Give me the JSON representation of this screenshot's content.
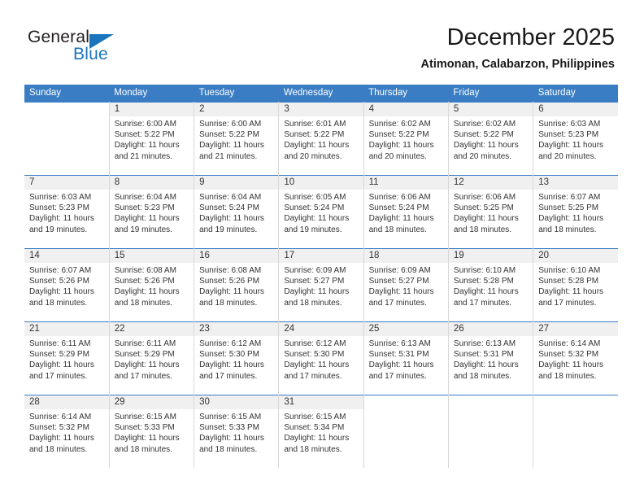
{
  "logo": {
    "word_top": "General",
    "word_bottom": "Blue",
    "triangle_color": "#1b75bc"
  },
  "header": {
    "title": "December 2025",
    "subtitle": "Atimonan, Calabarzon, Philippines"
  },
  "theme": {
    "header_blue": "#3b7dc4",
    "daynum_band": "#f0f0f0",
    "text": "#333333"
  },
  "weekday_headers": [
    "Sunday",
    "Monday",
    "Tuesday",
    "Wednesday",
    "Thursday",
    "Friday",
    "Saturday"
  ],
  "labels": {
    "sunrise": "Sunrise:",
    "sunset": "Sunset:",
    "daylight": "Daylight:"
  },
  "weeks": [
    [
      {
        "day": "",
        "sunrise": "",
        "sunset": "",
        "daylight_line1": "",
        "daylight_line2": ""
      },
      {
        "day": "1",
        "sunrise": "Sunrise: 6:00 AM",
        "sunset": "Sunset: 5:22 PM",
        "daylight_line1": "Daylight: 11 hours",
        "daylight_line2": "and 21 minutes."
      },
      {
        "day": "2",
        "sunrise": "Sunrise: 6:00 AM",
        "sunset": "Sunset: 5:22 PM",
        "daylight_line1": "Daylight: 11 hours",
        "daylight_line2": "and 21 minutes."
      },
      {
        "day": "3",
        "sunrise": "Sunrise: 6:01 AM",
        "sunset": "Sunset: 5:22 PM",
        "daylight_line1": "Daylight: 11 hours",
        "daylight_line2": "and 20 minutes."
      },
      {
        "day": "4",
        "sunrise": "Sunrise: 6:02 AM",
        "sunset": "Sunset: 5:22 PM",
        "daylight_line1": "Daylight: 11 hours",
        "daylight_line2": "and 20 minutes."
      },
      {
        "day": "5",
        "sunrise": "Sunrise: 6:02 AM",
        "sunset": "Sunset: 5:22 PM",
        "daylight_line1": "Daylight: 11 hours",
        "daylight_line2": "and 20 minutes."
      },
      {
        "day": "6",
        "sunrise": "Sunrise: 6:03 AM",
        "sunset": "Sunset: 5:23 PM",
        "daylight_line1": "Daylight: 11 hours",
        "daylight_line2": "and 20 minutes."
      }
    ],
    [
      {
        "day": "7",
        "sunrise": "Sunrise: 6:03 AM",
        "sunset": "Sunset: 5:23 PM",
        "daylight_line1": "Daylight: 11 hours",
        "daylight_line2": "and 19 minutes."
      },
      {
        "day": "8",
        "sunrise": "Sunrise: 6:04 AM",
        "sunset": "Sunset: 5:23 PM",
        "daylight_line1": "Daylight: 11 hours",
        "daylight_line2": "and 19 minutes."
      },
      {
        "day": "9",
        "sunrise": "Sunrise: 6:04 AM",
        "sunset": "Sunset: 5:24 PM",
        "daylight_line1": "Daylight: 11 hours",
        "daylight_line2": "and 19 minutes."
      },
      {
        "day": "10",
        "sunrise": "Sunrise: 6:05 AM",
        "sunset": "Sunset: 5:24 PM",
        "daylight_line1": "Daylight: 11 hours",
        "daylight_line2": "and 19 minutes."
      },
      {
        "day": "11",
        "sunrise": "Sunrise: 6:06 AM",
        "sunset": "Sunset: 5:24 PM",
        "daylight_line1": "Daylight: 11 hours",
        "daylight_line2": "and 18 minutes."
      },
      {
        "day": "12",
        "sunrise": "Sunrise: 6:06 AM",
        "sunset": "Sunset: 5:25 PM",
        "daylight_line1": "Daylight: 11 hours",
        "daylight_line2": "and 18 minutes."
      },
      {
        "day": "13",
        "sunrise": "Sunrise: 6:07 AM",
        "sunset": "Sunset: 5:25 PM",
        "daylight_line1": "Daylight: 11 hours",
        "daylight_line2": "and 18 minutes."
      }
    ],
    [
      {
        "day": "14",
        "sunrise": "Sunrise: 6:07 AM",
        "sunset": "Sunset: 5:26 PM",
        "daylight_line1": "Daylight: 11 hours",
        "daylight_line2": "and 18 minutes."
      },
      {
        "day": "15",
        "sunrise": "Sunrise: 6:08 AM",
        "sunset": "Sunset: 5:26 PM",
        "daylight_line1": "Daylight: 11 hours",
        "daylight_line2": "and 18 minutes."
      },
      {
        "day": "16",
        "sunrise": "Sunrise: 6:08 AM",
        "sunset": "Sunset: 5:26 PM",
        "daylight_line1": "Daylight: 11 hours",
        "daylight_line2": "and 18 minutes."
      },
      {
        "day": "17",
        "sunrise": "Sunrise: 6:09 AM",
        "sunset": "Sunset: 5:27 PM",
        "daylight_line1": "Daylight: 11 hours",
        "daylight_line2": "and 18 minutes."
      },
      {
        "day": "18",
        "sunrise": "Sunrise: 6:09 AM",
        "sunset": "Sunset: 5:27 PM",
        "daylight_line1": "Daylight: 11 hours",
        "daylight_line2": "and 17 minutes."
      },
      {
        "day": "19",
        "sunrise": "Sunrise: 6:10 AM",
        "sunset": "Sunset: 5:28 PM",
        "daylight_line1": "Daylight: 11 hours",
        "daylight_line2": "and 17 minutes."
      },
      {
        "day": "20",
        "sunrise": "Sunrise: 6:10 AM",
        "sunset": "Sunset: 5:28 PM",
        "daylight_line1": "Daylight: 11 hours",
        "daylight_line2": "and 17 minutes."
      }
    ],
    [
      {
        "day": "21",
        "sunrise": "Sunrise: 6:11 AM",
        "sunset": "Sunset: 5:29 PM",
        "daylight_line1": "Daylight: 11 hours",
        "daylight_line2": "and 17 minutes."
      },
      {
        "day": "22",
        "sunrise": "Sunrise: 6:11 AM",
        "sunset": "Sunset: 5:29 PM",
        "daylight_line1": "Daylight: 11 hours",
        "daylight_line2": "and 17 minutes."
      },
      {
        "day": "23",
        "sunrise": "Sunrise: 6:12 AM",
        "sunset": "Sunset: 5:30 PM",
        "daylight_line1": "Daylight: 11 hours",
        "daylight_line2": "and 17 minutes."
      },
      {
        "day": "24",
        "sunrise": "Sunrise: 6:12 AM",
        "sunset": "Sunset: 5:30 PM",
        "daylight_line1": "Daylight: 11 hours",
        "daylight_line2": "and 17 minutes."
      },
      {
        "day": "25",
        "sunrise": "Sunrise: 6:13 AM",
        "sunset": "Sunset: 5:31 PM",
        "daylight_line1": "Daylight: 11 hours",
        "daylight_line2": "and 17 minutes."
      },
      {
        "day": "26",
        "sunrise": "Sunrise: 6:13 AM",
        "sunset": "Sunset: 5:31 PM",
        "daylight_line1": "Daylight: 11 hours",
        "daylight_line2": "and 18 minutes."
      },
      {
        "day": "27",
        "sunrise": "Sunrise: 6:14 AM",
        "sunset": "Sunset: 5:32 PM",
        "daylight_line1": "Daylight: 11 hours",
        "daylight_line2": "and 18 minutes."
      }
    ],
    [
      {
        "day": "28",
        "sunrise": "Sunrise: 6:14 AM",
        "sunset": "Sunset: 5:32 PM",
        "daylight_line1": "Daylight: 11 hours",
        "daylight_line2": "and 18 minutes."
      },
      {
        "day": "29",
        "sunrise": "Sunrise: 6:15 AM",
        "sunset": "Sunset: 5:33 PM",
        "daylight_line1": "Daylight: 11 hours",
        "daylight_line2": "and 18 minutes."
      },
      {
        "day": "30",
        "sunrise": "Sunrise: 6:15 AM",
        "sunset": "Sunset: 5:33 PM",
        "daylight_line1": "Daylight: 11 hours",
        "daylight_line2": "and 18 minutes."
      },
      {
        "day": "31",
        "sunrise": "Sunrise: 6:15 AM",
        "sunset": "Sunset: 5:34 PM",
        "daylight_line1": "Daylight: 11 hours",
        "daylight_line2": "and 18 minutes."
      },
      {
        "day": "",
        "sunrise": "",
        "sunset": "",
        "daylight_line1": "",
        "daylight_line2": ""
      },
      {
        "day": "",
        "sunrise": "",
        "sunset": "",
        "daylight_line1": "",
        "daylight_line2": ""
      },
      {
        "day": "",
        "sunrise": "",
        "sunset": "",
        "daylight_line1": "",
        "daylight_line2": ""
      }
    ]
  ]
}
